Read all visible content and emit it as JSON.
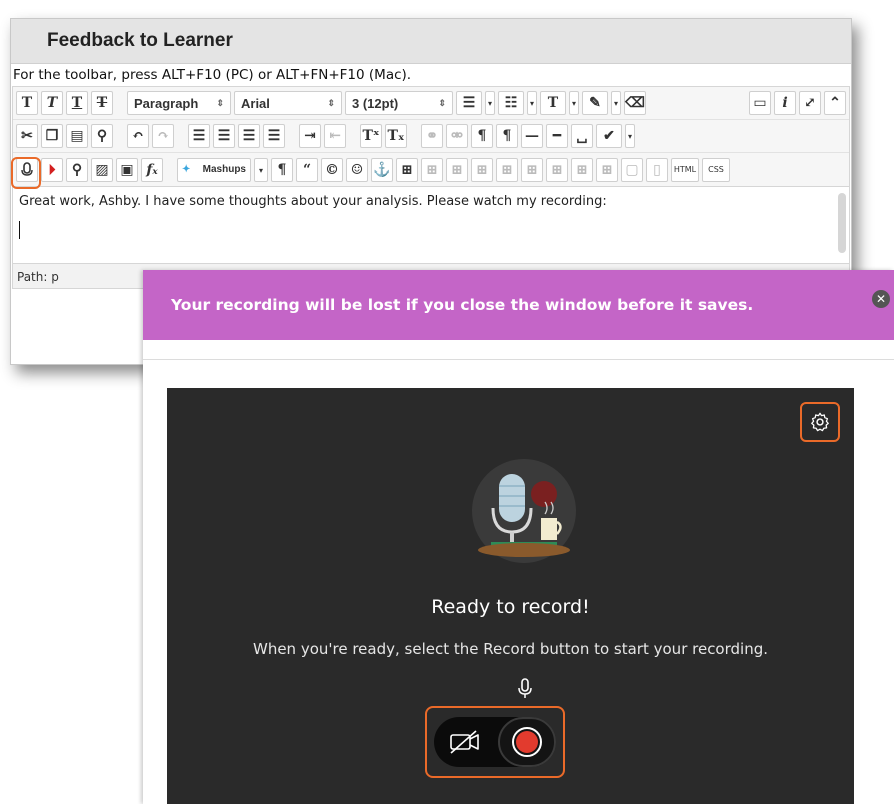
{
  "editor": {
    "title": "Feedback to Learner",
    "hint": "For the toolbar, press ALT+F10 (PC) or ALT+FN+F10 (Mac).",
    "format_select": "Paragraph",
    "font_select": "Arial",
    "size_select": "3 (12pt)",
    "mashups_label": "Mashups",
    "html_label": "HTML",
    "css_label": "CSS",
    "body_text": "Great work, Ashby. I have some thoughts about your analysis. Please watch my recording:",
    "path_label": "Path: p"
  },
  "recorder": {
    "warning": "Your recording will be lost if you close the window before it saves.",
    "title": "Ready to record!",
    "subtitle": "When you're ready, select the Record button to start your recording."
  },
  "colors": {
    "banner": "#c465c7",
    "highlight": "#ea6a29",
    "stage": "#2a2a2a",
    "record": "#e23b2e"
  }
}
